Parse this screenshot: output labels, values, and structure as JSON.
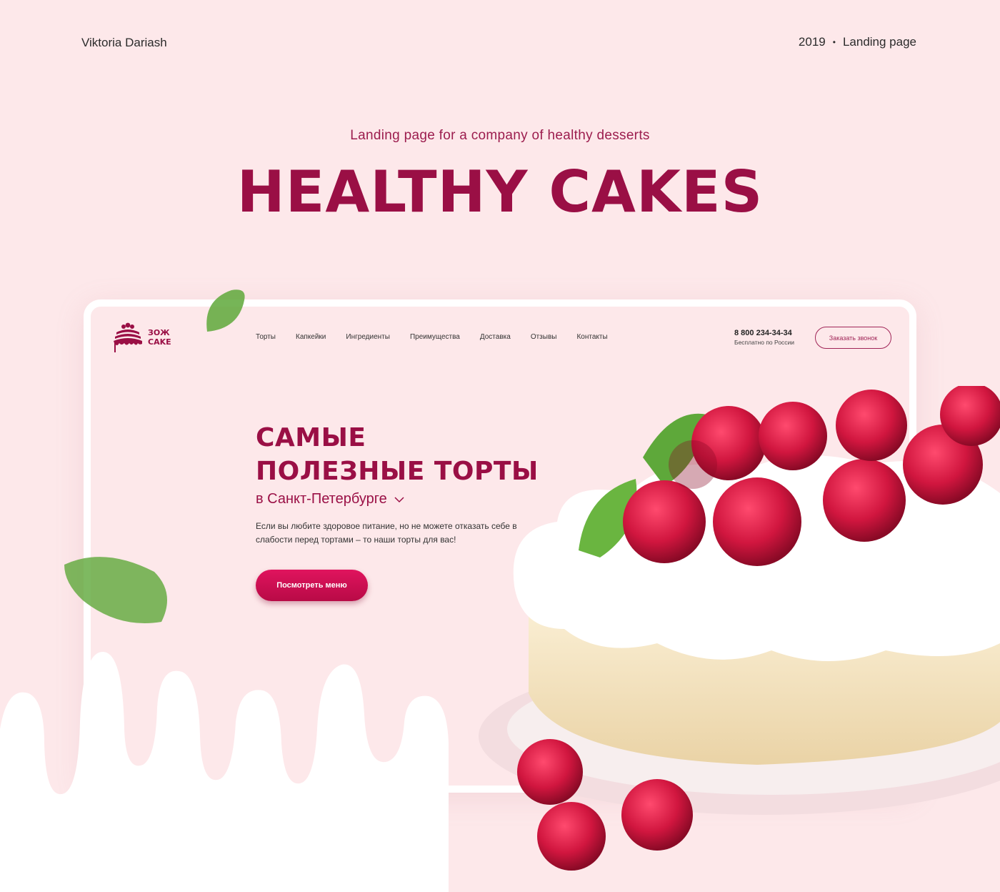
{
  "header": {
    "author": "Viktoria Dariash",
    "year": "2019",
    "separator": "•",
    "type": "Landing page"
  },
  "intro": {
    "subtitle": "Landing page for a company of healthy desserts",
    "title": "HEALTHY CAKES"
  },
  "site": {
    "logo": {
      "line1": "ЗОЖ",
      "line2": "CAKE"
    },
    "nav": [
      {
        "label": "Торты"
      },
      {
        "label": "Капкейки"
      },
      {
        "label": "Ингредиенты"
      },
      {
        "label": "Преимущества"
      },
      {
        "label": "Доставка"
      },
      {
        "label": "Отзывы"
      },
      {
        "label": "Контакты"
      }
    ],
    "phone": {
      "number": "8 800 234-34-34",
      "note": "Бесплатно по России"
    },
    "callback_label": "Заказать звонок",
    "hero": {
      "title_line1": "САМЫЕ",
      "title_line2": "ПОЛЕЗНЫЕ ТОРТЫ",
      "city": "в Санкт-Петербурге",
      "description": "Если вы любите здоровое питание, но не можете отказать себе в слабости перед тортами – то наши торты для вас!",
      "cta": "Посмотреть меню"
    }
  },
  "colors": {
    "background": "#fde8ea",
    "brand": "#9a0f45",
    "accent": "#e0145e"
  },
  "icons": [
    "cake-logo-icon",
    "chevron-down-icon",
    "mint-leaf-icon",
    "raspberry-cake-image"
  ]
}
